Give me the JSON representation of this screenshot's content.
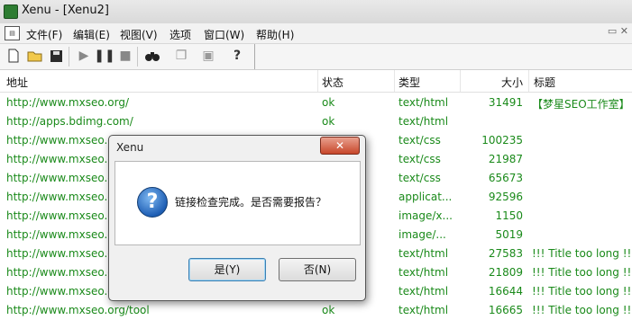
{
  "window": {
    "title": "Xenu - [Xenu2]"
  },
  "menu": [
    "文件(F)",
    "编辑(E)",
    "视图(V)",
    "选项",
    "窗口(W)",
    "帮助(H)"
  ],
  "toolbar": {
    "icons": [
      "new-file-icon",
      "open-folder-icon",
      "save-icon",
      "play-icon",
      "pause-icon",
      "stop-icon",
      "binoculars-icon",
      "copy-icon",
      "properties-icon",
      "help-icon"
    ]
  },
  "columns": {
    "url": "地址",
    "state": "状态",
    "type": "类型",
    "size": "大小",
    "title": "标题"
  },
  "rows": [
    {
      "url": "http://www.mxseo.org/",
      "state": "ok",
      "type": "text/html",
      "size": "31491",
      "title": "【梦星SEO工作室】"
    },
    {
      "url": "http://apps.bdimg.com/",
      "state": "ok",
      "type": "text/html",
      "size": "",
      "title": ""
    },
    {
      "url": "http://www.mxseo.o",
      "state": "",
      "type": "text/css",
      "size": "100235",
      "title": ""
    },
    {
      "url": "http://www.mxseo.o",
      "state": "",
      "type": "text/css",
      "size": "21987",
      "title": ""
    },
    {
      "url": "http://www.mxseo.o",
      "state": "",
      "type": "text/css",
      "size": "65673",
      "title": ""
    },
    {
      "url": "http://www.mxseo.o",
      "state": "",
      "type": "applicat...",
      "size": "92596",
      "title": ""
    },
    {
      "url": "http://www.mxseo.o",
      "state": "",
      "type": "image/x...",
      "size": "1150",
      "title": ""
    },
    {
      "url": "http://www.mxseo.o",
      "state": "",
      "type": "image/...",
      "size": "5019",
      "title": ""
    },
    {
      "url": "http://www.mxseo.o",
      "state": "",
      "type": "text/html",
      "size": "27583",
      "title": "!!! Title too long !!!"
    },
    {
      "url": "http://www.mxseo.o",
      "state": "",
      "type": "text/html",
      "size": "21809",
      "title": "!!! Title too long !!!"
    },
    {
      "url": "http://www.mxseo.o",
      "state": "",
      "type": "text/html",
      "size": "16644",
      "title": "!!! Title too long !!!"
    },
    {
      "url": "http://www.mxseo.org/tool",
      "state": "ok",
      "type": "text/html",
      "size": "16665",
      "title": "!!! Title too long !!!"
    }
  ],
  "dialog": {
    "title": "Xenu",
    "close": "✕",
    "message": "链接检查完成。是否需要报告？",
    "yes": "是(Y)",
    "no": "否(N)"
  },
  "colors": {
    "link": "#1a8a1a",
    "accent": "#1f5fb5"
  }
}
